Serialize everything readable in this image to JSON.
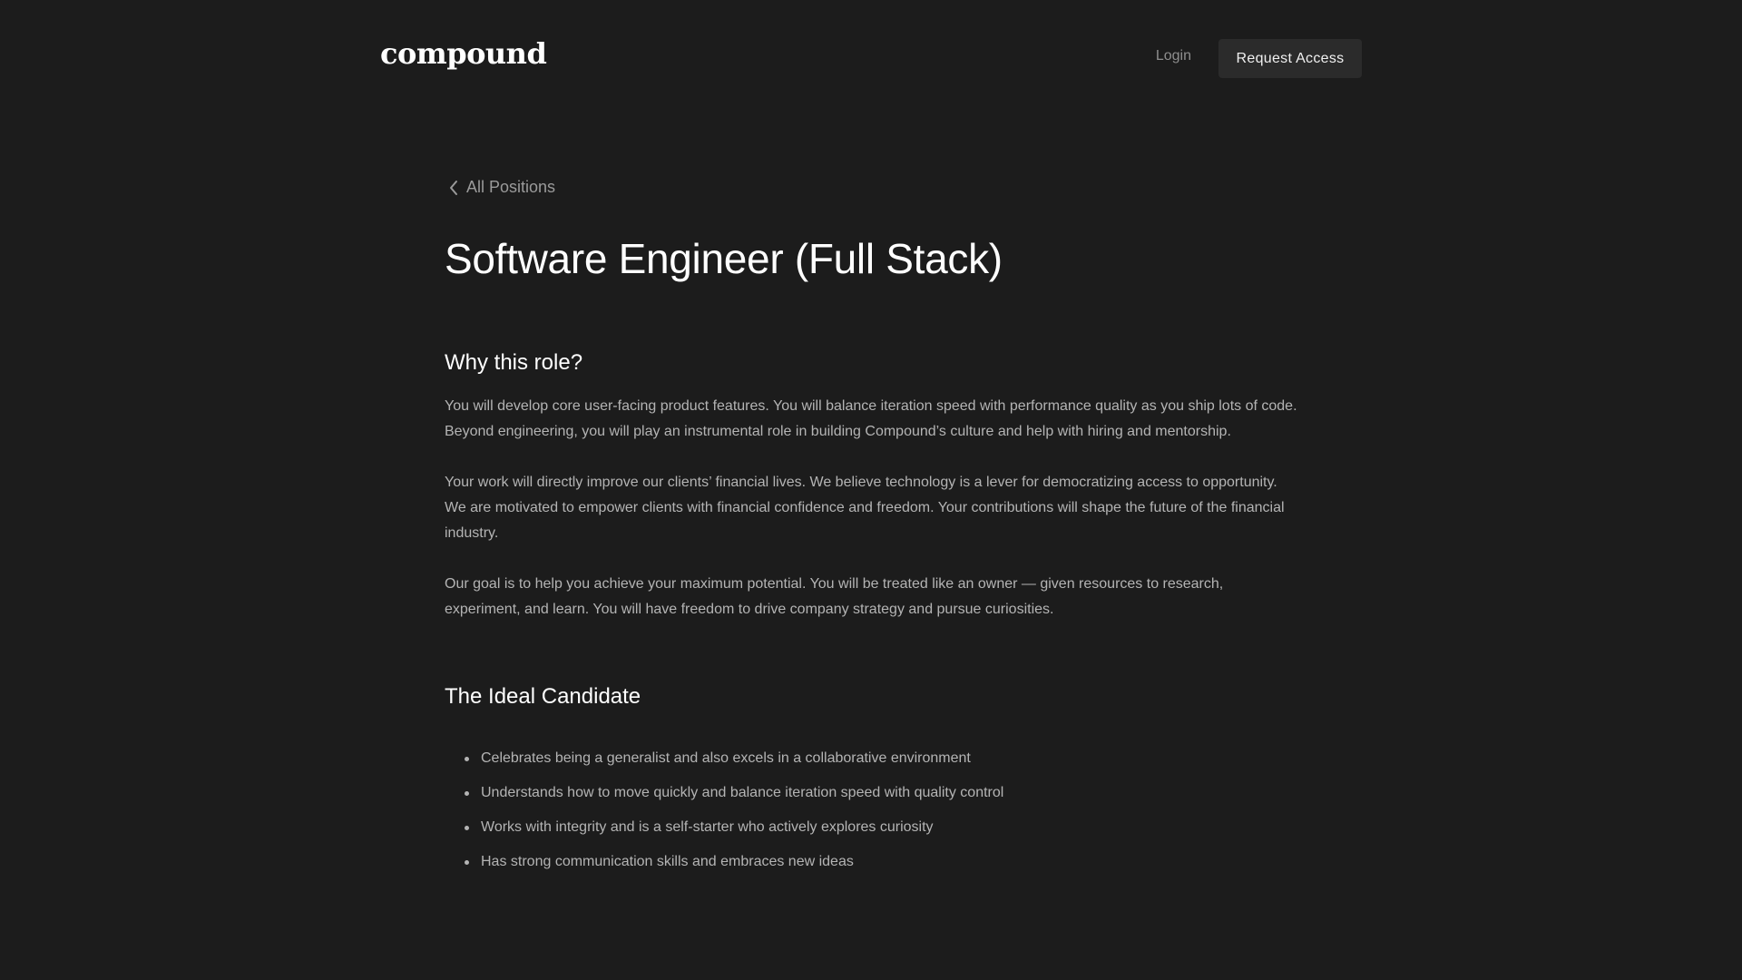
{
  "header": {
    "logo": "compound",
    "login_label": "Login",
    "request_access_label": "Request Access"
  },
  "main": {
    "back_label": "All Positions",
    "title": "Software Engineer (Full Stack)",
    "why_heading": "Why this role?",
    "paragraphs": [
      "You will develop core user-facing product features. You will balance iteration speed with performance quality as you ship lots of code. Beyond engineering, you will play an instrumental role in building Compound’s culture and help with hiring and mentorship.",
      "Your work will directly improve our clients’ financial lives. We believe technology is a lever for democratizing access to opportunity. We are motivated to empower clients with financial confidence and freedom. Your contributions will shape the future of the financial industry.",
      "Our goal is to help you achieve your maximum potential. You will be treated like an owner — given resources to research, experiment, and learn. You will have freedom to drive company strategy and pursue curiosities."
    ],
    "ideal_heading": "The Ideal Candidate",
    "ideal_items": [
      "Celebrates being a generalist and also excels in a collaborative environment",
      "Understands how to move quickly and balance iteration speed with quality control",
      "Works with integrity and is a self-starter who actively explores curiosity",
      "Has strong communication skills and embraces new ideas"
    ]
  },
  "icons": {
    "back": "chevron-left-icon"
  },
  "colors": {
    "background": "#1c1c1c",
    "button_bg": "#2b2b2b",
    "heading": "#ffffff",
    "body_text": "#b4b4b4",
    "muted": "#8e8e8e"
  }
}
